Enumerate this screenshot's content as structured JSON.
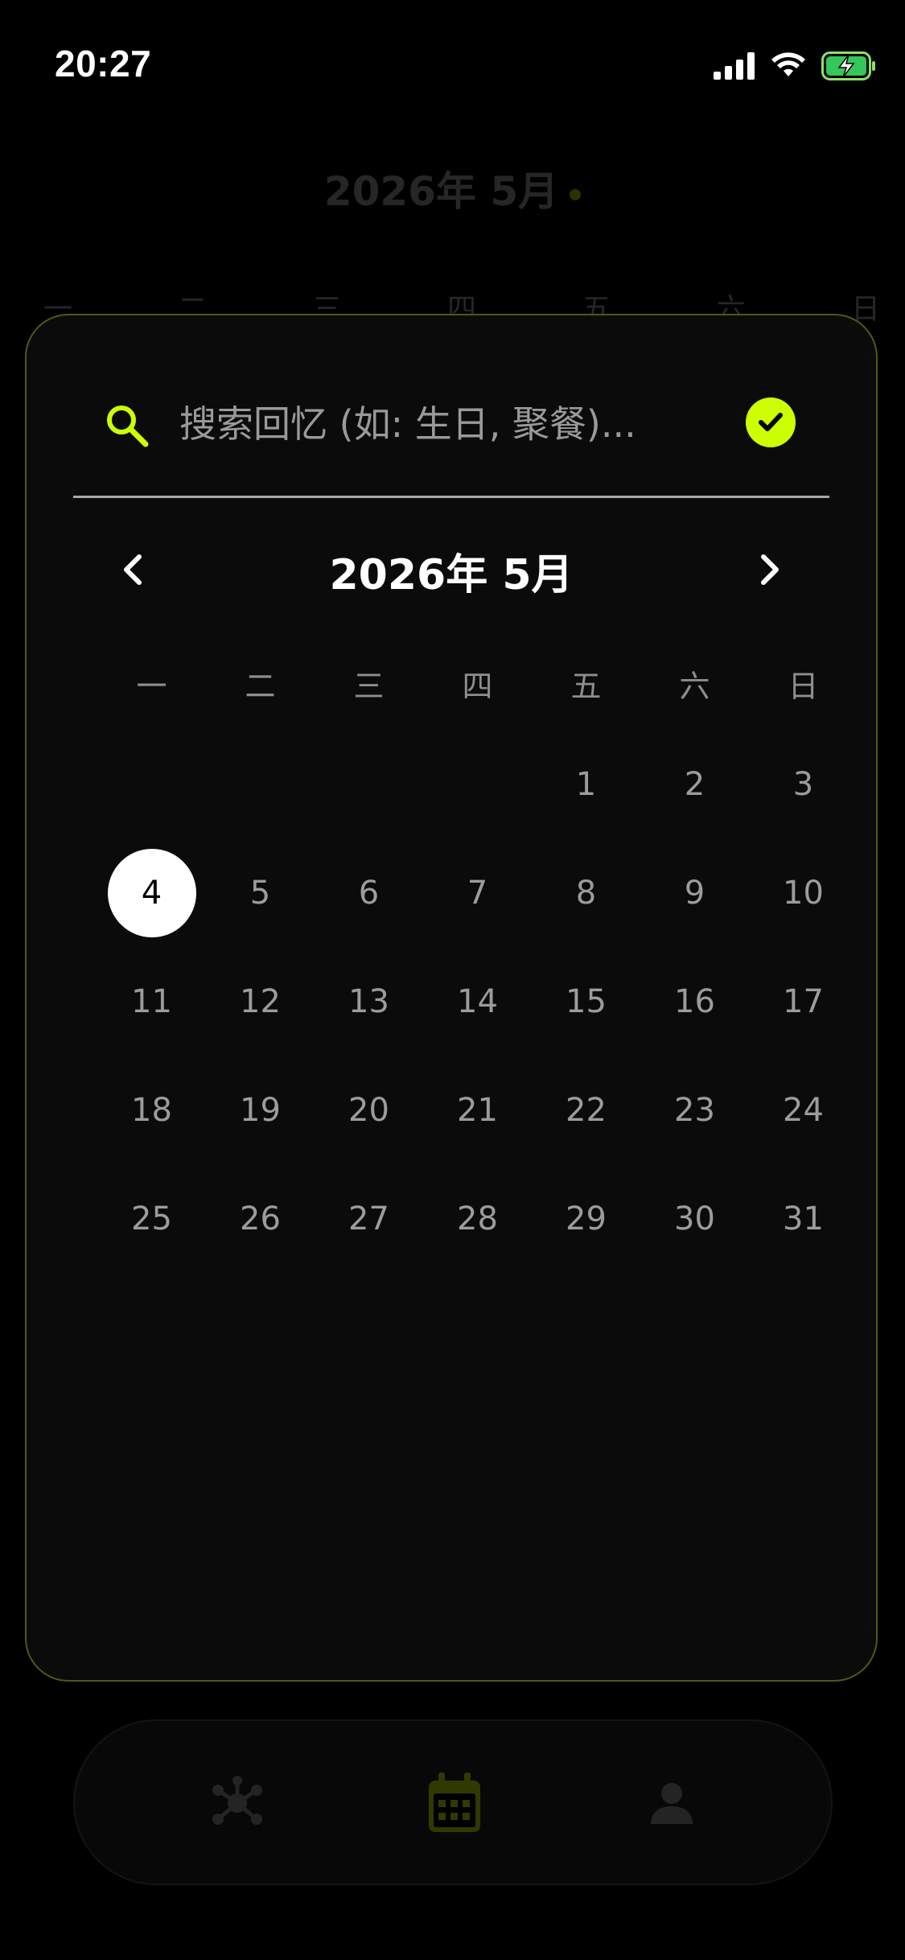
{
  "status_bar": {
    "time": "20:27"
  },
  "background": {
    "month_title": "2026年 5月",
    "weekdays": [
      "一",
      "二",
      "三",
      "四",
      "五",
      "六",
      "日"
    ]
  },
  "search": {
    "placeholder": "搜索回忆 (如: 生日, 聚餐)..."
  },
  "calendar": {
    "month_title": "2026年 5月",
    "weekdays": [
      "一",
      "二",
      "三",
      "四",
      "五",
      "六",
      "日"
    ],
    "leading_blank_days": 4,
    "days": [
      "1",
      "2",
      "3",
      "4",
      "5",
      "6",
      "7",
      "8",
      "9",
      "10",
      "11",
      "12",
      "13",
      "14",
      "15",
      "16",
      "17",
      "18",
      "19",
      "20",
      "21",
      "22",
      "23",
      "24",
      "25",
      "26",
      "27",
      "28",
      "29",
      "30",
      "31"
    ],
    "selected_day": "4"
  },
  "icons": {
    "search": "search-icon",
    "confirm": "check-circle-icon",
    "prev": "chevron-left-icon",
    "next": "chevron-right-icon",
    "tabs": [
      "graph-nodes-icon",
      "calendar-icon",
      "person-icon"
    ]
  },
  "colors": {
    "accent": "#ccff00",
    "card_border": "#4d5a12",
    "background": "#000000"
  }
}
